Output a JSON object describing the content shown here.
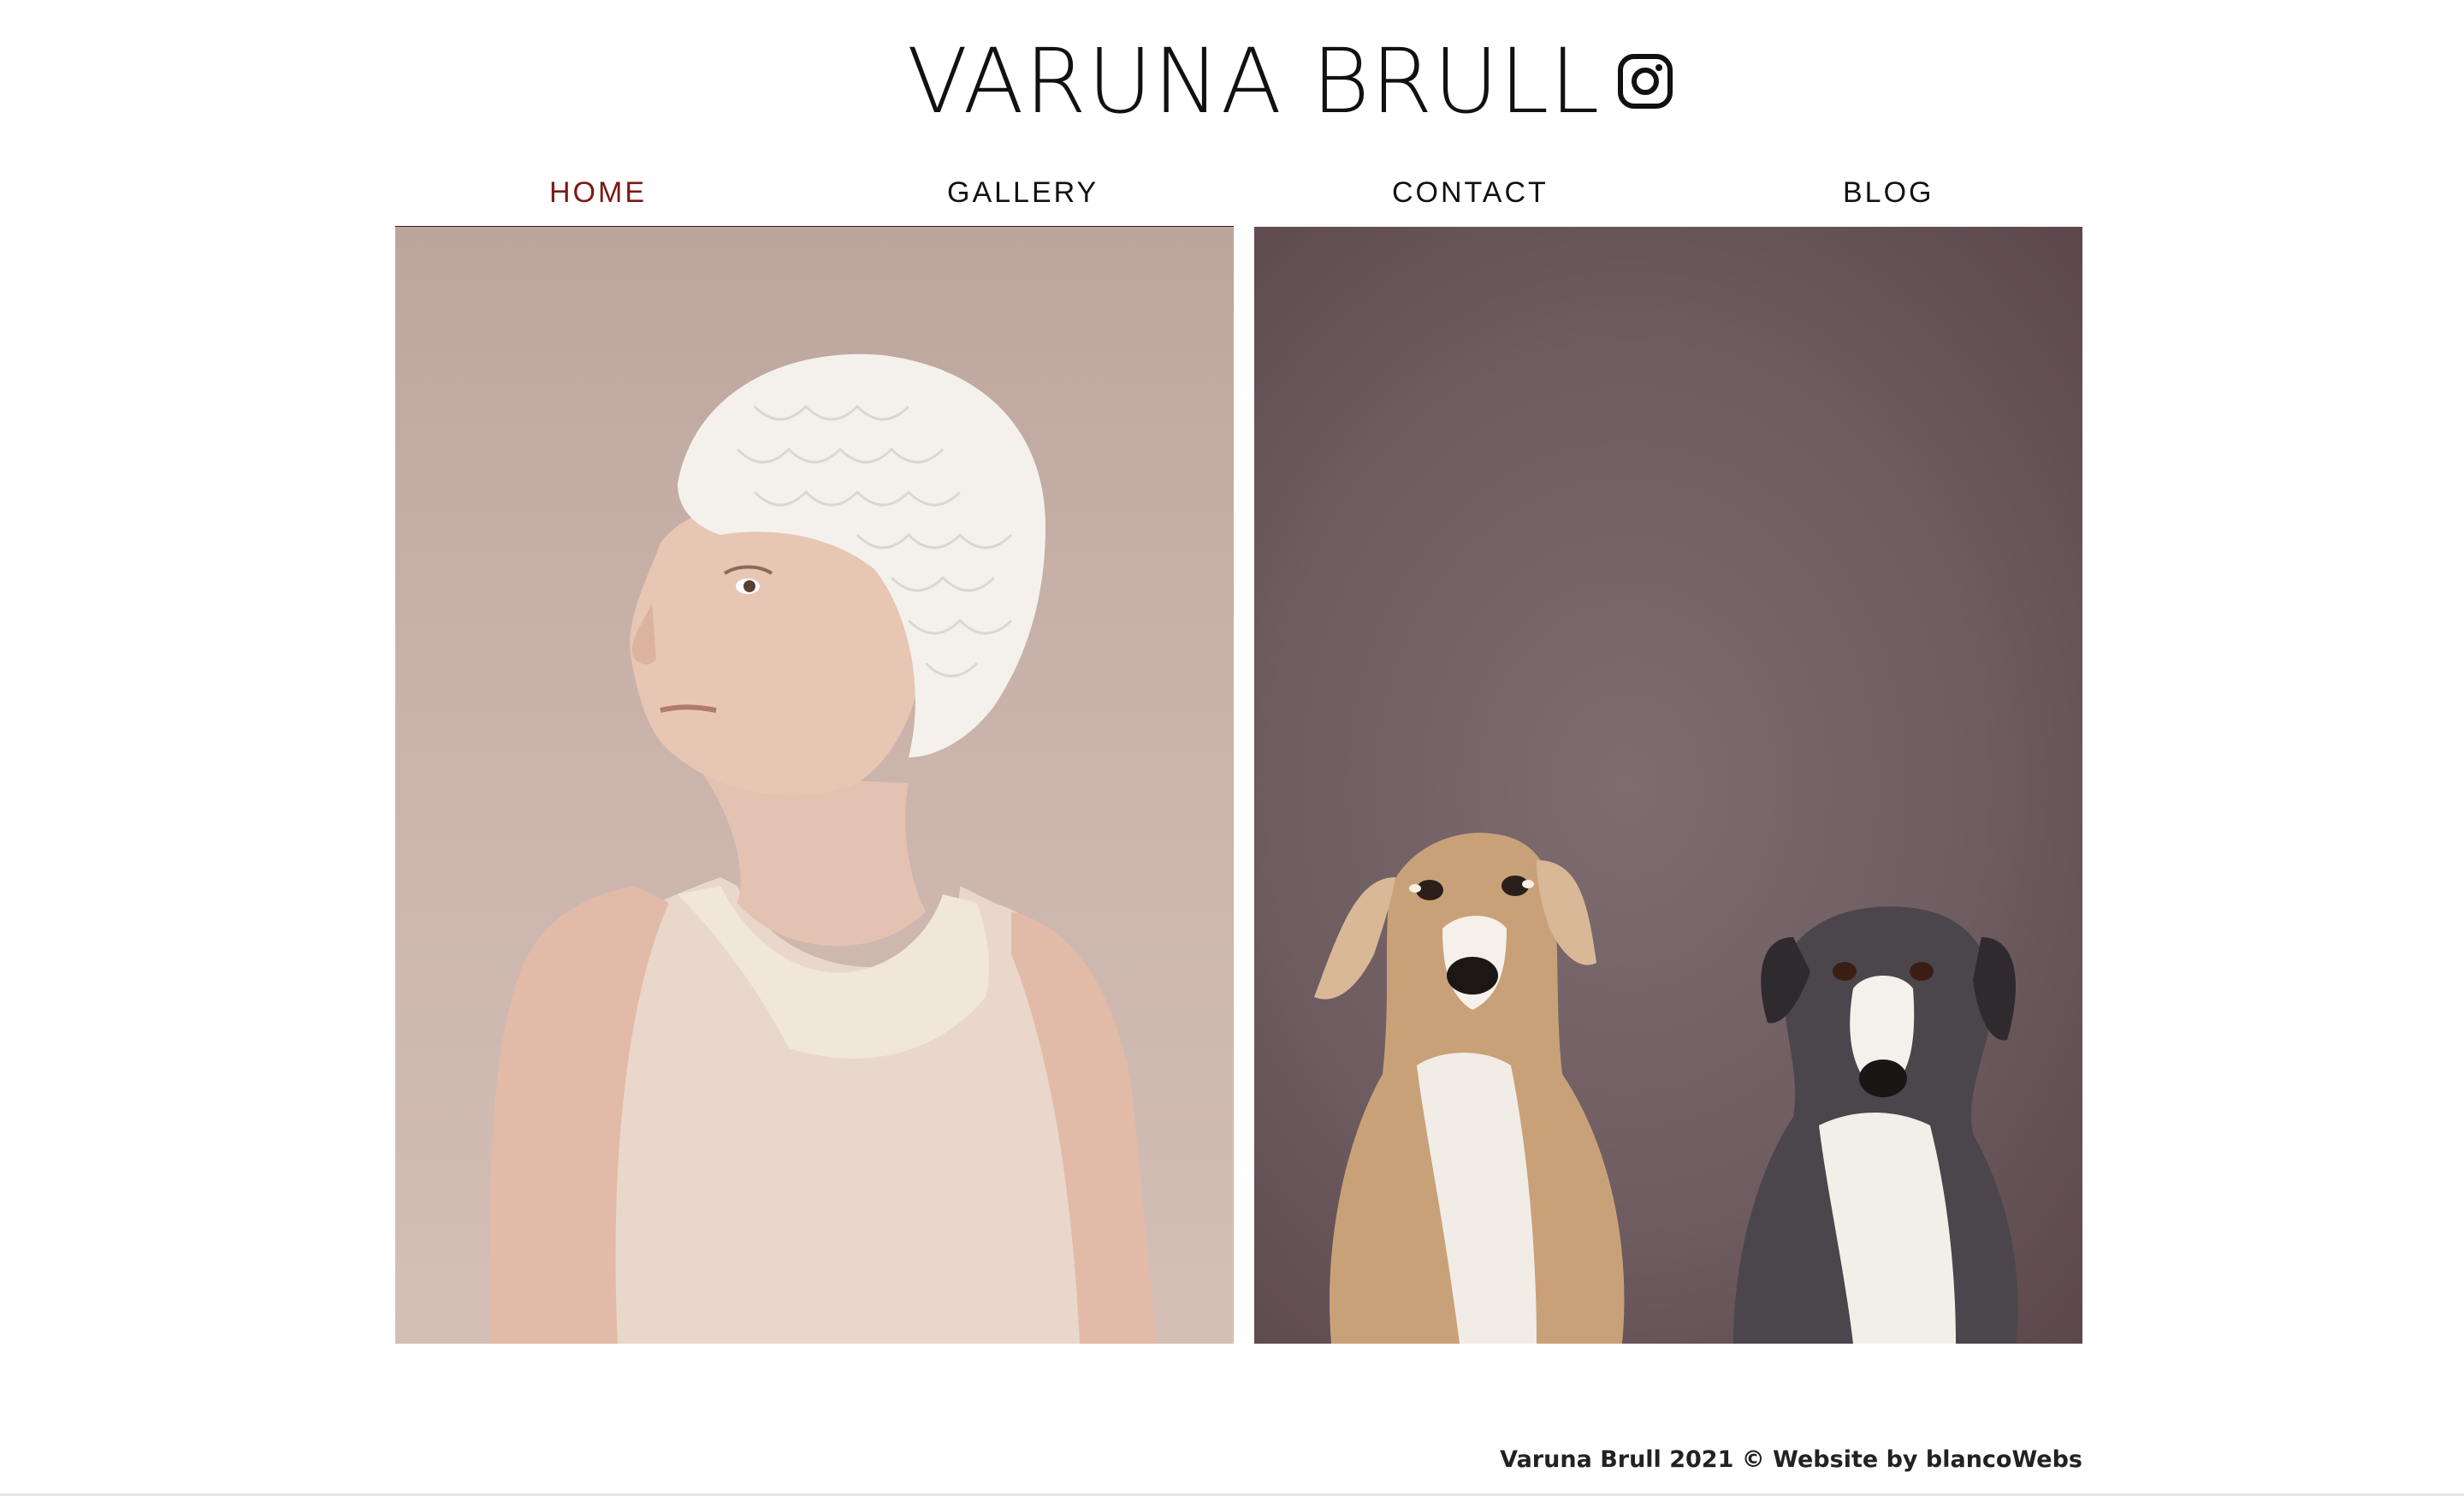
{
  "site": {
    "title": "VARUNA BRULL",
    "social_icon": "instagram-icon"
  },
  "nav": {
    "items": [
      {
        "label": "HOME",
        "active": true
      },
      {
        "label": "GALLERY",
        "active": false
      },
      {
        "label": "CONTACT",
        "active": false
      },
      {
        "label": "BLOG",
        "active": false
      }
    ],
    "active_color": "#7a1a12"
  },
  "gallery": {
    "images": [
      {
        "subject": "portrait of woman in white swim cap and tank top"
      },
      {
        "subject": "two greyhound dogs against mauve background"
      }
    ]
  },
  "footer": {
    "text": "Varuna Brull 2021 © Website by blancoWebs"
  }
}
